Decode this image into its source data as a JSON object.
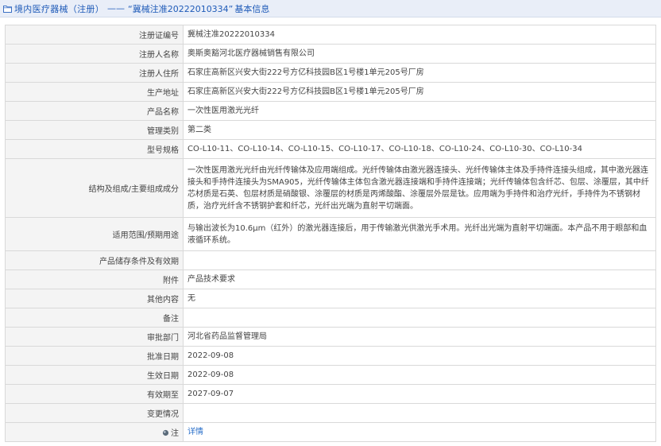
{
  "header": {
    "breadcrumb_category": "境内医疗器械（注册）",
    "breadcrumb_separator": "——",
    "breadcrumb_record": "“冀械注准20222010334”",
    "breadcrumb_page": "基本信息"
  },
  "rows": [
    {
      "label": "注册证编号",
      "value": "冀械注准20222010334"
    },
    {
      "label": "注册人名称",
      "value": "奥斯奥豁河北医疗器械销售有限公司"
    },
    {
      "label": "注册人住所",
      "value": "石家庄高新区兴安大街222号方亿科技园B区1号楼1单元205号厂房"
    },
    {
      "label": "生产地址",
      "value": "石家庄高新区兴安大街222号方亿科技园B区1号楼1单元205号厂房"
    },
    {
      "label": "产品名称",
      "value": "一次性医用激光光纤"
    },
    {
      "label": "管理类别",
      "value": "第二类"
    },
    {
      "label": "型号规格",
      "value": "CO-L10-11、CO-L10-14、CO-L10-15、CO-L10-17、CO-L10-18、CO-L10-24、CO-L10-30、CO-L10-34"
    },
    {
      "label": "结构及组成/主要组成成分",
      "value": "一次性医用激光光纤由光纤传输体及应用端组成。光纤传输体由激光器连接头、光纤传输体主体及手持件连接头组成，其中激光器连接头和手持件连接头为SMA905，光纤传输体主体包含激光器连接端和手持件连接端；光纤传输体包含纤芯、包层、涂覆层，其中纤芯材质是石英、包层材质是硝酸银、涂覆层的材质是丙烯酸酯、涂覆层外层是钛。应用端为手持件和治疗光纤，手持件为不锈钢材质，治疗光纤含不锈钢护套和纤芯，光纤出光端为直射平切端面。"
    },
    {
      "label": "适用范围/预期用途",
      "value": "与输出波长为10.6μm（红外）的激光器连接后，用于传输激光供激光手术用。光纤出光端为直射平切端面。本产品不用于眼部和血液循环系统。"
    },
    {
      "label": "产品储存条件及有效期",
      "value": ""
    },
    {
      "label": "附件",
      "value": "产品技术要求"
    },
    {
      "label": "其他内容",
      "value": "无"
    },
    {
      "label": "备注",
      "value": ""
    },
    {
      "label": "审批部门",
      "value": "河北省药品监督管理局"
    },
    {
      "label": "批准日期",
      "value": "2022-09-08"
    },
    {
      "label": "生效日期",
      "value": "2022-09-08"
    },
    {
      "label": "有效期至",
      "value": "2027-09-07"
    },
    {
      "label": "变更情况",
      "value": ""
    },
    {
      "label": "注",
      "value": "详情"
    }
  ]
}
